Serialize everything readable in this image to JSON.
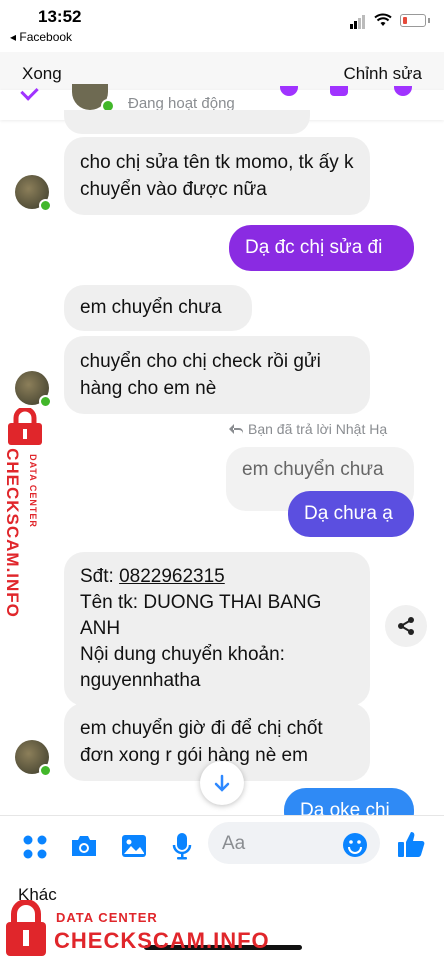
{
  "status_bar": {
    "time": "13:52",
    "back_app": "◂ Facebook"
  },
  "nav": {
    "done": "Xong",
    "edit": "Chỉnh sửa"
  },
  "header": {
    "status": "Đang hoạt động"
  },
  "messages": {
    "m1": "cho chị sửa tên tk momo, tk ấy k chuyển vào được nữa",
    "m2": "Dạ đc chị sửa đi",
    "m3": "em chuyển chưa",
    "m4": "chuyển cho chị check rồi gửi hàng cho em nè",
    "reply_note": "Bạn đã trả lời Nhật Hạ",
    "quoted": "em chuyển chưa",
    "m5": "Dạ chưa ạ",
    "m6_l1_prefix": "Sđt: ",
    "m6_phone": "0822962315",
    "m6_l2": "Tên tk: DUONG THAI BANG ANH",
    "m6_l3": "Nội dung chuyển khoản: nguyennhatha",
    "m7": "em chuyển giờ đi để chị chốt đơn xong r gói hàng nè em",
    "m8": "Dạ oke chị"
  },
  "composer": {
    "placeholder": "Aa"
  },
  "bottom": {
    "khac": "Khác"
  },
  "watermark": {
    "side_label": "DATA CENTER",
    "side_brand": "CHECKSCAM.INFO",
    "bottom_label": "DATA CENTER",
    "bottom_brand": "CHECKSCAM.INFO"
  },
  "colors": {
    "outgoing_purple": "#8a2be2",
    "outgoing_blue": "#5b4fe0",
    "incoming": "#efefef",
    "accent": "#0084ff",
    "watermark": "#e0262b"
  }
}
